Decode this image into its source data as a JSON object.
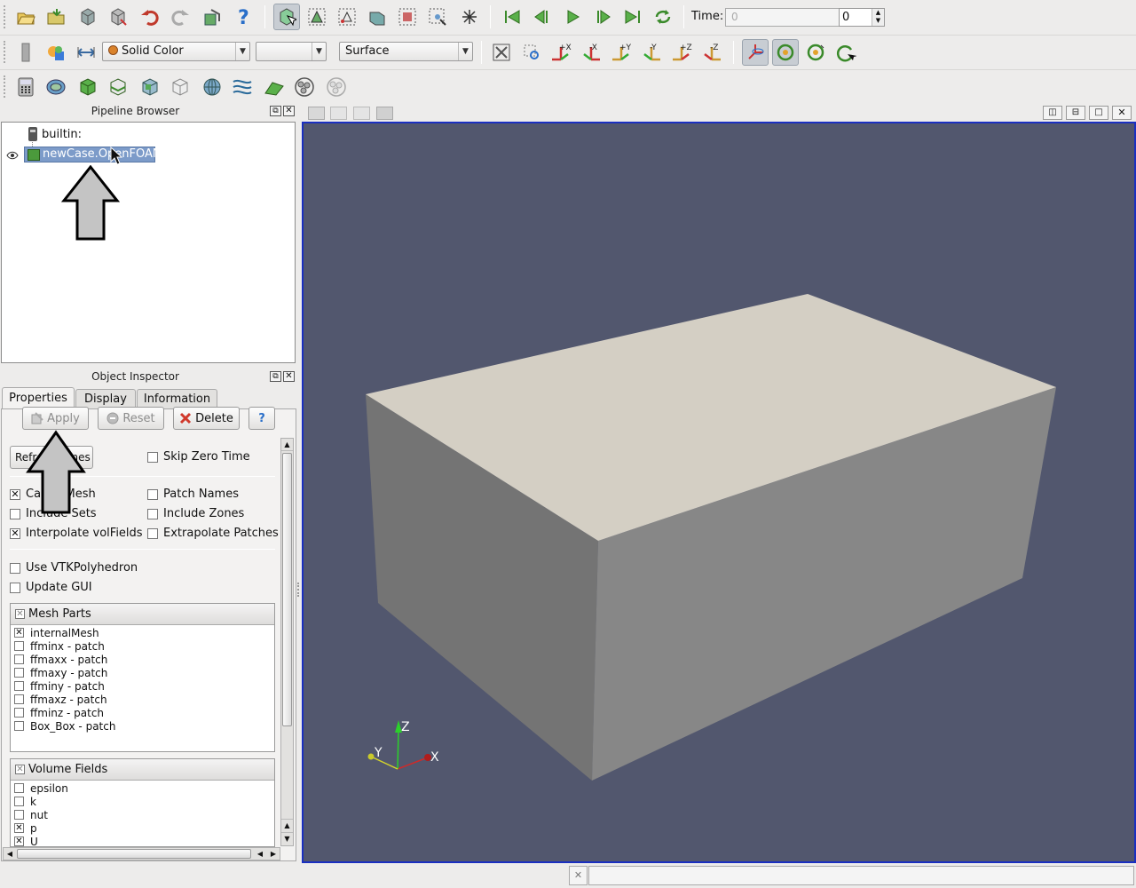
{
  "toolbar1": {
    "time_label": "Time:",
    "time_value": "0",
    "time_step": "0"
  },
  "toolbar2": {
    "color_by": "Solid Color",
    "component": "",
    "representation": "Surface"
  },
  "pipeline": {
    "title": "Pipeline Browser",
    "items": [
      {
        "label": "builtin:"
      },
      {
        "label": "newCase.OpenFOAM"
      }
    ]
  },
  "inspector": {
    "title": "Object Inspector",
    "tabs": [
      "Properties",
      "Display",
      "Information"
    ],
    "apply": "Apply",
    "reset": "Reset",
    "delete": "Delete",
    "help": "?",
    "refresh": "Refresh Times",
    "skip_zero_time": "Skip Zero Time",
    "cache_mesh": "Cache Mesh",
    "patch_names": "Patch Names",
    "include_sets": "Include Sets",
    "include_zones": "Include Zones",
    "interpolate_volfields": "Interpolate volFields",
    "extrapolate_patches": "Extrapolate Patches",
    "use_vtkpolyhedron": "Use VTKPolyhedron",
    "update_gui": "Update GUI",
    "mesh_parts_title": "Mesh Parts",
    "mesh_parts": [
      {
        "label": "internalMesh",
        "checked": true
      },
      {
        "label": "ffminx - patch",
        "checked": false
      },
      {
        "label": "ffmaxx - patch",
        "checked": false
      },
      {
        "label": "ffmaxy - patch",
        "checked": false
      },
      {
        "label": "ffminy - patch",
        "checked": false
      },
      {
        "label": "ffmaxz - patch",
        "checked": false
      },
      {
        "label": "ffminz - patch",
        "checked": false
      },
      {
        "label": "Box_Box - patch",
        "checked": false
      }
    ],
    "volume_fields_title": "Volume Fields",
    "volume_fields": [
      {
        "label": "epsilon",
        "checked": false
      },
      {
        "label": "k",
        "checked": false
      },
      {
        "label": "nut",
        "checked": false
      },
      {
        "label": "p",
        "checked": true
      },
      {
        "label": "U",
        "checked": true
      }
    ]
  },
  "view": {
    "background": "#52576e",
    "axes": {
      "x": "X",
      "y": "Y",
      "z": "Z"
    }
  }
}
